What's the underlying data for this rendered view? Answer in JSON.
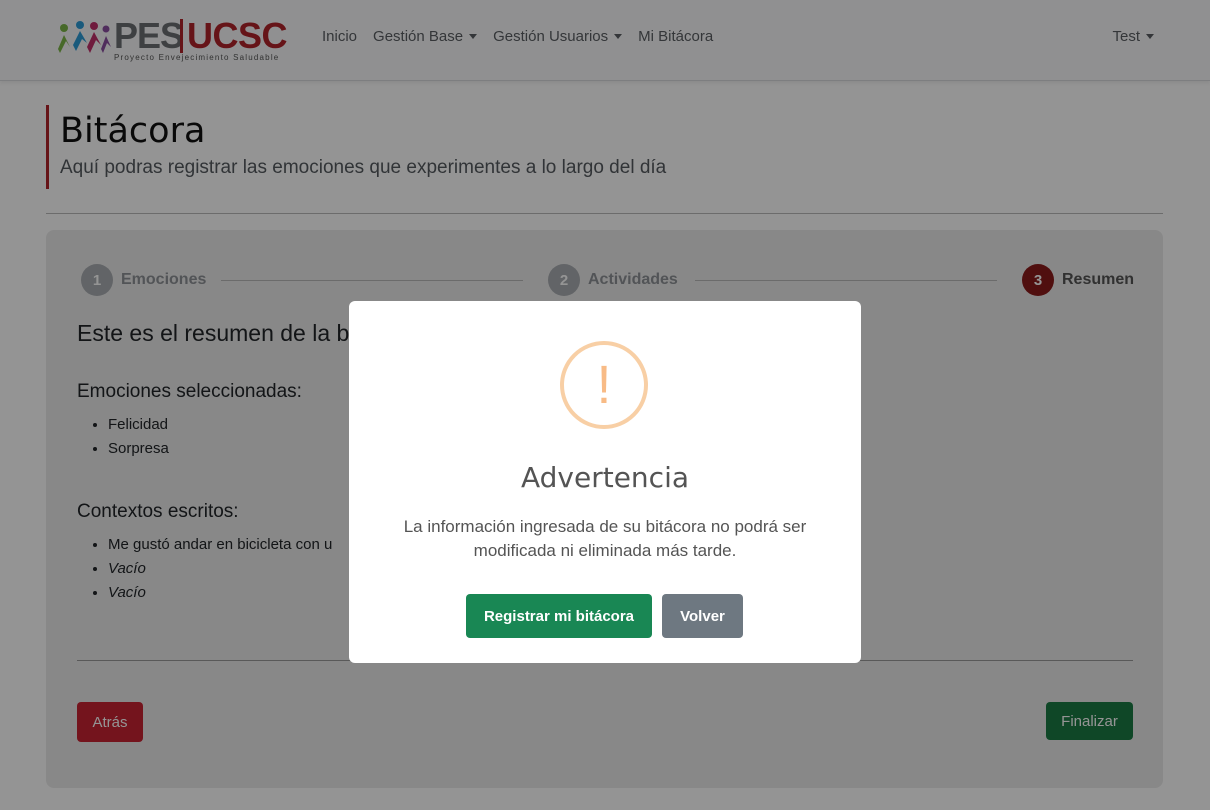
{
  "navbar": {
    "logo": {
      "primary": "PES",
      "secondary": "UCSC",
      "tagline": "Proyecto Envejecimiento Saludable"
    },
    "links": [
      {
        "label": "Inicio",
        "dropdown": false
      },
      {
        "label": "Gestión Base",
        "dropdown": true
      },
      {
        "label": "Gestión Usuarios",
        "dropdown": true
      },
      {
        "label": "Mi Bitácora",
        "dropdown": false
      }
    ],
    "user": "Test"
  },
  "header": {
    "title": "Bitácora",
    "subtitle": "Aquí podras registrar las emociones que experimentes a lo largo del día"
  },
  "stepper": [
    {
      "number": "1",
      "label": "Emociones",
      "active": false
    },
    {
      "number": "2",
      "label": "Actividades",
      "active": false
    },
    {
      "number": "3",
      "label": "Resumen",
      "active": true
    }
  ],
  "summary": {
    "title": "Este es el resumen de la b",
    "emotions_title": "Emociones seleccionadas:",
    "emotions": [
      "Felicidad",
      "Sorpresa"
    ],
    "contexts_title": "Contextos escritos:",
    "contexts": [
      "Me gustó andar en bicicleta con u",
      "Vacío",
      "Vacío"
    ]
  },
  "buttons": {
    "back": "Atrás",
    "finish": "Finalizar"
  },
  "modal": {
    "icon": "warning-icon",
    "icon_glyph": "!",
    "title": "Advertencia",
    "message": "La información ingresada de su bitácora no podrá ser modificada ni eliminada más tarde.",
    "confirm": "Registrar mi bitácora",
    "cancel": "Volver"
  },
  "colors": {
    "brand_red": "#b0232a",
    "success": "#198754",
    "secondary": "#6e7881",
    "warning_ring": "#f8cfa5"
  }
}
